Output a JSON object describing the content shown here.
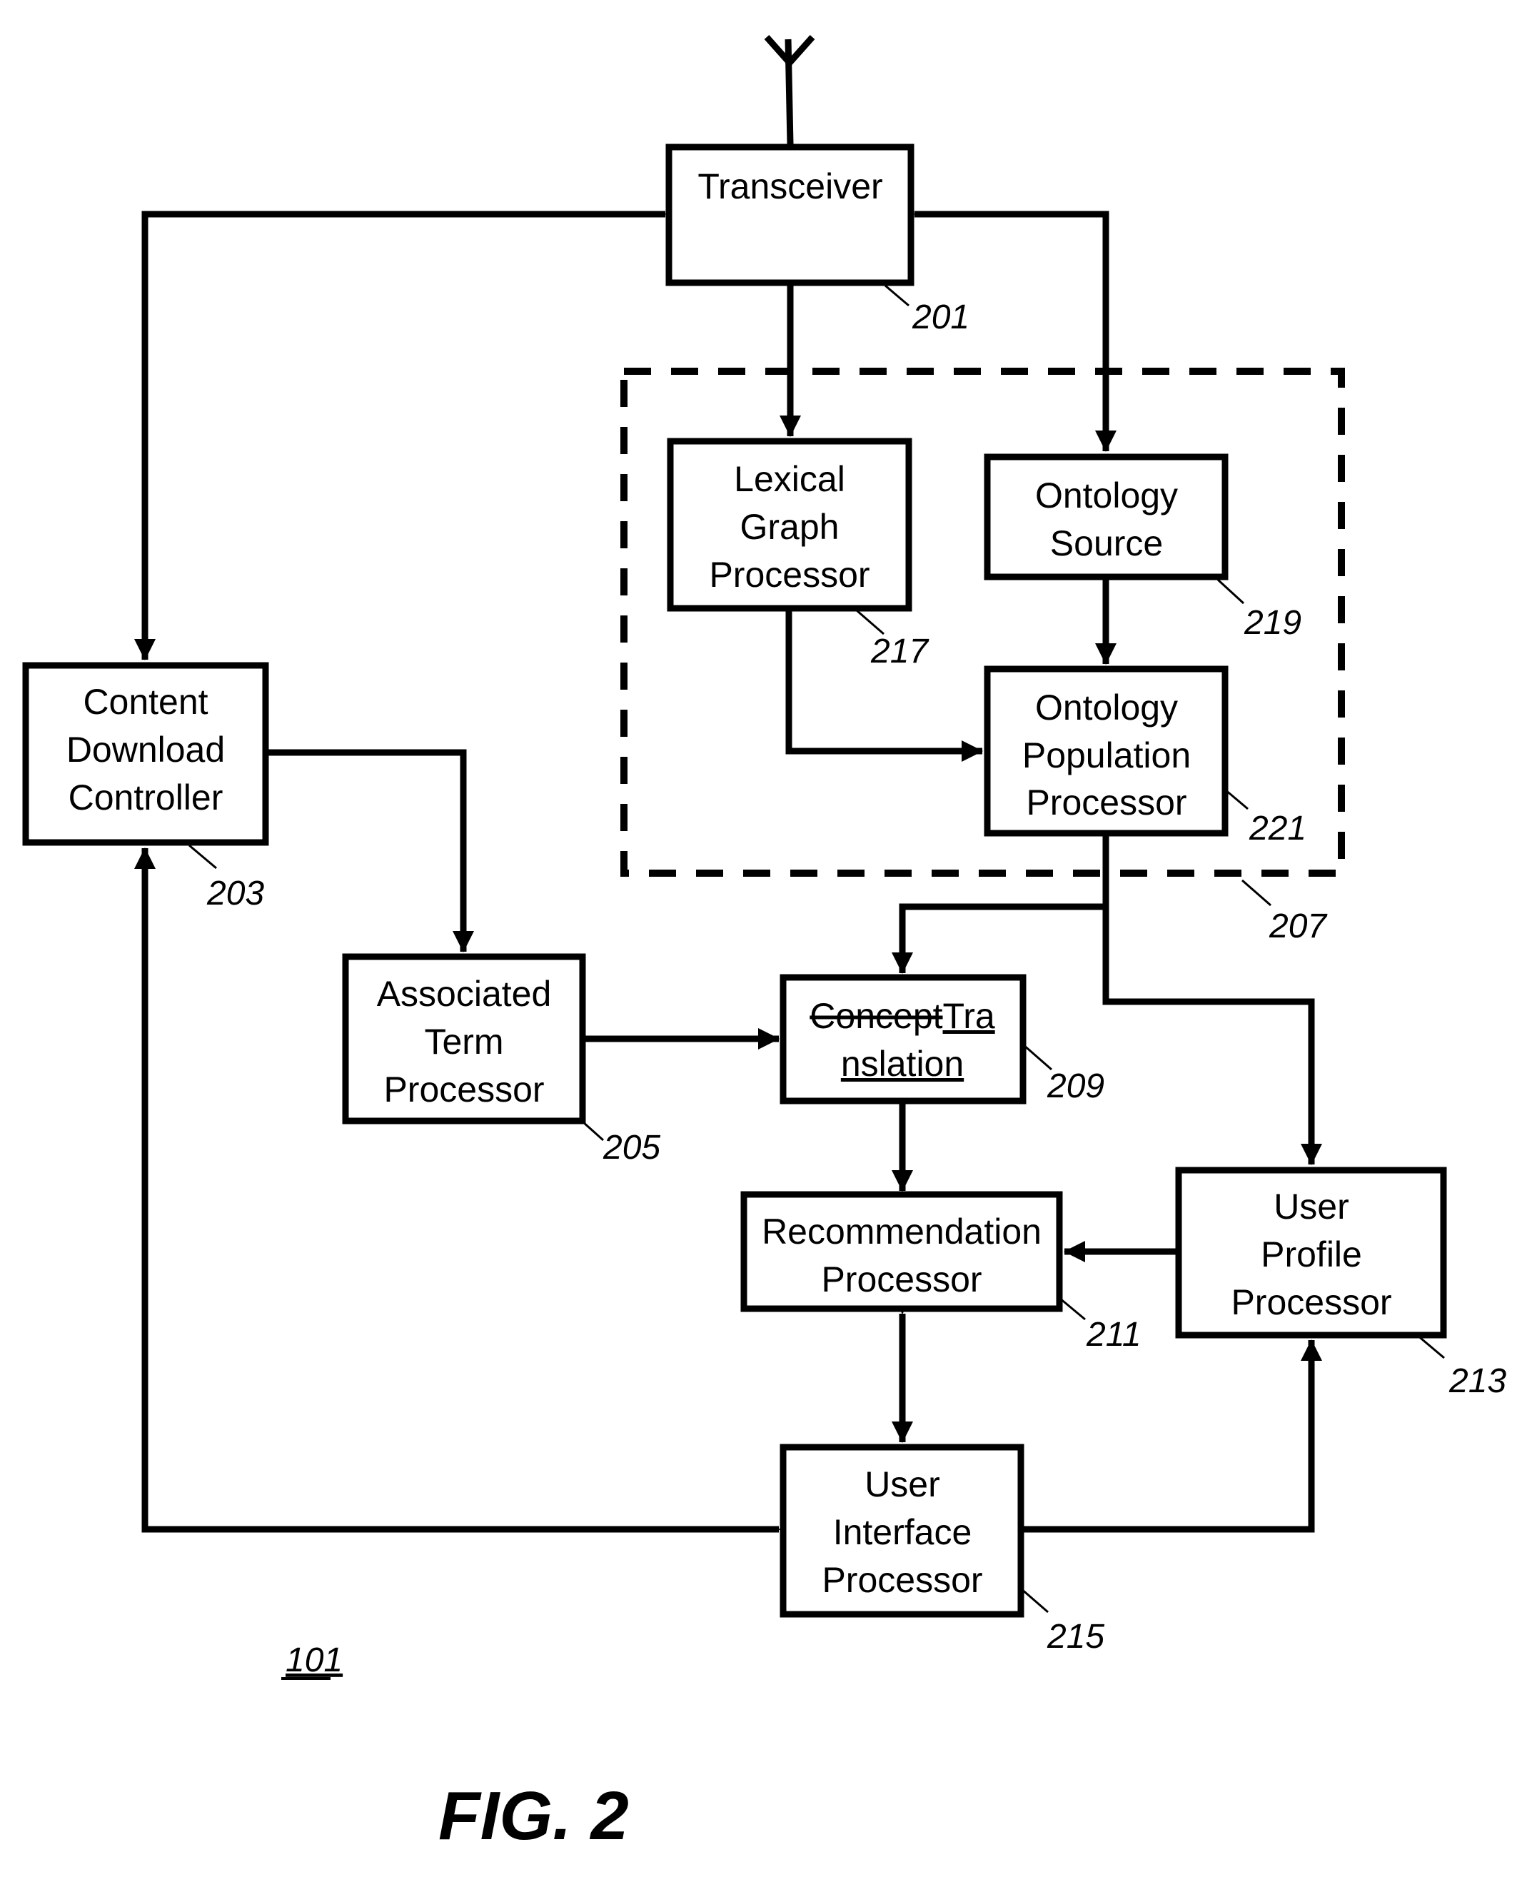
{
  "figure": {
    "caption": "FIG. 2",
    "system_ref": "101"
  },
  "blocks": {
    "transceiver": {
      "lines": [
        "Transceiver"
      ],
      "ref": "201"
    },
    "content_download_controller": {
      "lines": [
        "Content",
        "Download",
        "Controller"
      ],
      "ref": "203"
    },
    "associated_term_processor": {
      "lines": [
        "Associated",
        "Term",
        "Processor"
      ],
      "ref": "205"
    },
    "ontology_group": {
      "ref": "207"
    },
    "translation": {
      "struck": "Concept",
      "inserted_line1": "Tra",
      "inserted_line2": "nslation",
      "ref": "209"
    },
    "recommendation_processor": {
      "lines": [
        "Recommendation",
        "Processor"
      ],
      "ref": "211"
    },
    "user_profile_processor": {
      "lines": [
        "User",
        "Profile",
        "Processor"
      ],
      "ref": "213"
    },
    "user_interface_processor": {
      "lines": [
        "User",
        "Interface",
        "Processor"
      ],
      "ref": "215"
    },
    "lexical_graph_processor": {
      "lines": [
        "Lexical",
        "Graph",
        "Processor"
      ],
      "ref": "217"
    },
    "ontology_source": {
      "lines": [
        "Ontology",
        "Source"
      ],
      "ref": "219"
    },
    "ontology_population_processor": {
      "lines": [
        "Ontology",
        "Population",
        "Processor"
      ],
      "ref": "221"
    }
  },
  "connections": [
    {
      "from": "transceiver",
      "to": "content_download_controller",
      "direction": "bidirectional"
    },
    {
      "from": "transceiver",
      "to": "ontology_source",
      "direction": "bidirectional"
    },
    {
      "from": "transceiver",
      "to": "lexical_graph_processor",
      "direction": "forward"
    },
    {
      "from": "lexical_graph_processor",
      "to": "ontology_population_processor",
      "direction": "forward"
    },
    {
      "from": "ontology_source",
      "to": "ontology_population_processor",
      "direction": "forward"
    },
    {
      "from": "ontology_population_processor",
      "to": "translation",
      "direction": "forward"
    },
    {
      "from": "ontology_population_processor",
      "to": "user_profile_processor",
      "direction": "forward"
    },
    {
      "from": "content_download_controller",
      "to": "associated_term_processor",
      "direction": "forward"
    },
    {
      "from": "associated_term_processor",
      "to": "translation",
      "direction": "forward"
    },
    {
      "from": "translation",
      "to": "recommendation_processor",
      "direction": "forward"
    },
    {
      "from": "user_profile_processor",
      "to": "recommendation_processor",
      "direction": "forward"
    },
    {
      "from": "recommendation_processor",
      "to": "user_interface_processor",
      "direction": "bidirectional"
    },
    {
      "from": "user_interface_processor",
      "to": "content_download_controller",
      "direction": "bidirectional"
    },
    {
      "from": "user_interface_processor",
      "to": "user_profile_processor",
      "direction": "forward"
    }
  ]
}
